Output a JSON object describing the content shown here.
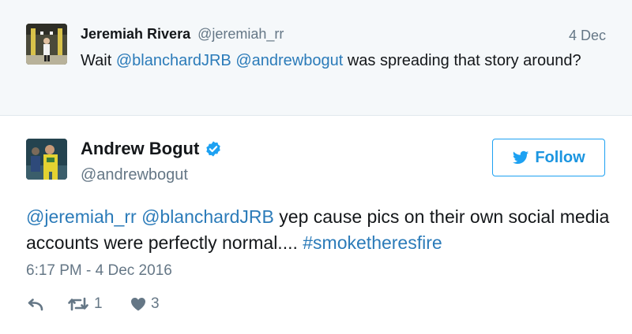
{
  "reply_context": {
    "name": "Jeremiah Rivera",
    "handle": "@jeremiah_rr",
    "date": "4 Dec",
    "text_prefix": "Wait ",
    "mention_1": "@blanchardJRB",
    "mention_2": "@andrewbogut",
    "text_suffix": " was spreading that story around?"
  },
  "tweet": {
    "name": "Andrew Bogut",
    "handle": "@andrewbogut",
    "verified_icon": "verified-badge-icon",
    "follow_label": "Follow",
    "mention_1": "@jeremiah_rr",
    "mention_2": "@blanchardJRB",
    "text_body": " yep cause pics on their own social media accounts were perfectly normal.... ",
    "hashtag": "#smoketheresfire",
    "timestamp": "6:17 PM - 4 Dec 2016",
    "retweet_count": "1",
    "like_count": "3"
  },
  "colors": {
    "link": "#2b7bb9",
    "accent": "#1da1f2",
    "muted": "#657786",
    "context_bg": "#f5f8fa"
  }
}
